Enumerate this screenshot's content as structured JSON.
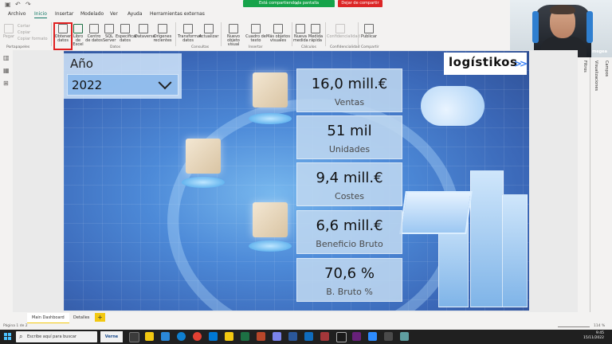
{
  "share": {
    "sharing_text": "Está compartiendo la pantalla",
    "stop_label": "Dejar de compartir"
  },
  "menu": {
    "tabs": [
      "Archivo",
      "Inicio",
      "Insertar",
      "Modelado",
      "Ver",
      "Ayuda",
      "Herramientas externas"
    ]
  },
  "ribbon": {
    "paste": "Pegar",
    "cut": "Cortar",
    "copy": "Copiar",
    "copy_format": "Copiar formato",
    "clipboard_group": "Portapapeles",
    "get_data": "Obtener datos",
    "excel_workbook": "Libro de Excel",
    "data_hub": "Centro de datos",
    "sql_server": "SQL Server",
    "enter_data": "Especificar datos",
    "dataverse": "Dataverse",
    "recent_sources": "Orígenes recientes",
    "data_group": "Datos",
    "transform": "Transformar datos",
    "refresh": "Actualizar",
    "queries_group": "Consultas",
    "new_visual": "Nuevo objeto visual",
    "text_box": "Cuadro de texto",
    "more_visuals": "Más objetos visuales",
    "insert_group": "Insertar",
    "new_measure": "Nueva medida",
    "quick_measure": "Medida rápida",
    "calc_group": "Cálculos",
    "sensitivity": "Confidencialidad",
    "sensitivity_group": "Confidencialidad",
    "publish": "Publicar",
    "share_group": "Compartir"
  },
  "webcam": {
    "name": "megea"
  },
  "report": {
    "year_title": "Año",
    "year_value": "2022",
    "logo": "logístikos",
    "logo_arrow": ">>",
    "kpis": [
      {
        "value": "16,0 mill.€",
        "label": "Ventas"
      },
      {
        "value": "51 mil",
        "label": "Unidades"
      },
      {
        "value": "9,4 mill.€",
        "label": "Costes"
      },
      {
        "value": "6,6 mill.€",
        "label": "Beneficio Bruto"
      },
      {
        "value": "70,6 %",
        "label": "B. Bruto %"
      }
    ]
  },
  "panes": {
    "filters": "Filtros",
    "visualizations": "Visualizaciones",
    "fields": "Campos"
  },
  "pages": {
    "tabs": [
      "Main Dashboard",
      "Detalles"
    ],
    "add": "+"
  },
  "status": {
    "page": "Página 1 de 2",
    "zoom": "114 %"
  },
  "taskbar": {
    "search_placeholder": "Escribe aquí para buscar",
    "verne": "Verne",
    "time": "9:45",
    "date": "15/11/2022"
  }
}
